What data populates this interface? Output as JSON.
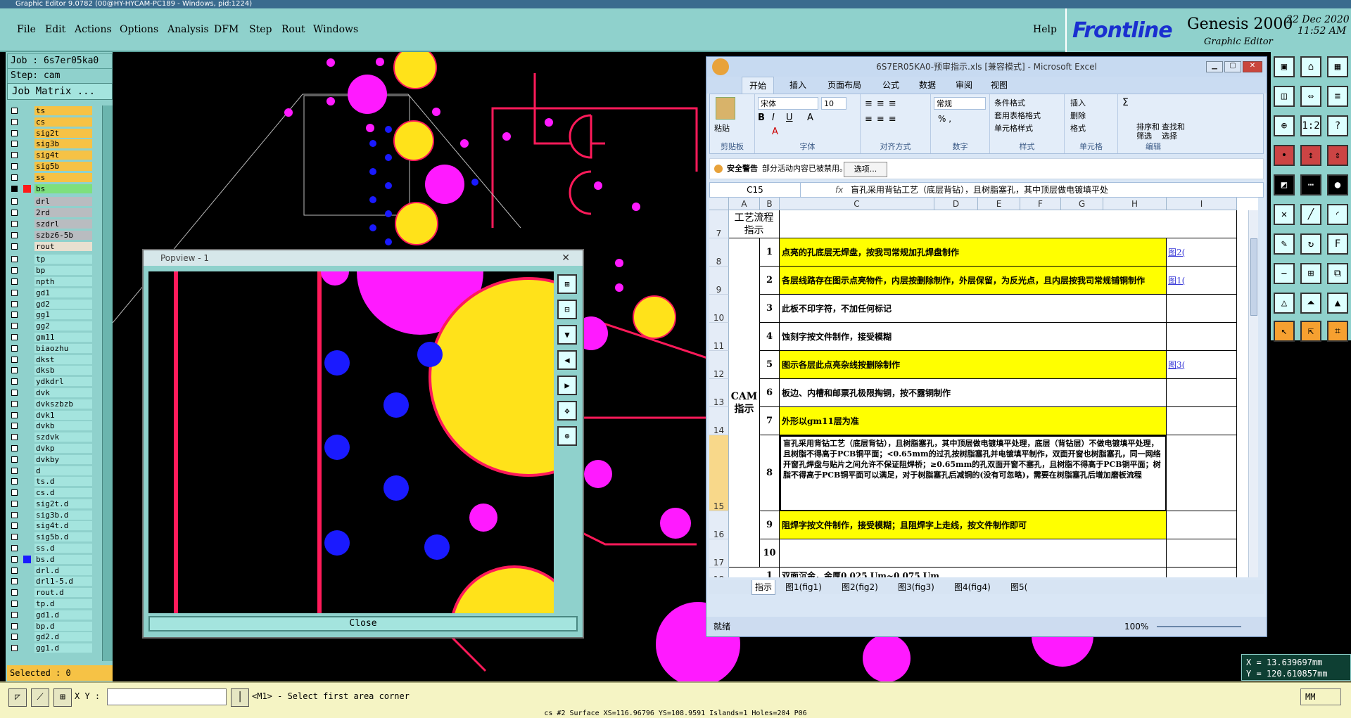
{
  "window": {
    "title": "Graphic Editor 9.0782 (00@HY-HYCAM-PC189 - Windows, pid:1224)"
  },
  "menu": {
    "items": [
      "File",
      "Edit",
      "Actions",
      "Options",
      "Analysis",
      "DFM",
      "Step",
      "Rout",
      "Windows"
    ],
    "help": "Help"
  },
  "brand": {
    "logo": "Frontline",
    "product": "Genesis 2000",
    "subtitle": "Graphic Editor",
    "date": "22 Dec 2020",
    "time": "11:52 AM"
  },
  "job": {
    "job_label": "Job : 6s7er05ka0",
    "step_label": "Step: cam",
    "matrix_button": "Job Matrix ..."
  },
  "layers": [
    {
      "name": "ts",
      "color": "#f6c245",
      "checked": false
    },
    {
      "name": "cs",
      "color": "#f6c245",
      "checked": false
    },
    {
      "name": "sig2t",
      "color": "#f6c245",
      "checked": false
    },
    {
      "name": "sig3b",
      "color": "#f6c245",
      "checked": false
    },
    {
      "name": "sig4t",
      "color": "#f6c245",
      "checked": false
    },
    {
      "name": "sig5b",
      "color": "#f6c245",
      "checked": false
    },
    {
      "name": "ss",
      "color": "#f6c245",
      "checked": false
    },
    {
      "name": "bs",
      "color": "#7de07d",
      "checked": true,
      "swatch": "#ff1a1a"
    },
    {
      "name": "drl",
      "color": "#b9bcc0",
      "checked": false
    },
    {
      "name": "2rd",
      "color": "#b9bcc0",
      "checked": false
    },
    {
      "name": "szdrl",
      "color": "#b9bcc0",
      "checked": false
    },
    {
      "name": "szbz6-5b",
      "color": "#b9bcc0",
      "checked": false
    },
    {
      "name": "rout",
      "color": "#e8e0d0",
      "checked": false
    },
    {
      "name": "tp",
      "color": "#a4e4de",
      "checked": false
    },
    {
      "name": "bp",
      "color": "#a4e4de",
      "checked": false
    },
    {
      "name": "npth",
      "color": "#a4e4de",
      "checked": false
    },
    {
      "name": "gd1",
      "color": "#a4e4de",
      "checked": false
    },
    {
      "name": "gd2",
      "color": "#a4e4de",
      "checked": false
    },
    {
      "name": "gg1",
      "color": "#a4e4de",
      "checked": false
    },
    {
      "name": "gg2",
      "color": "#a4e4de",
      "checked": false
    },
    {
      "name": "gm11",
      "color": "#a4e4de",
      "checked": false
    },
    {
      "name": "biaozhu",
      "color": "#a4e4de",
      "checked": false
    },
    {
      "name": "dkst",
      "color": "#a4e4de",
      "checked": false
    },
    {
      "name": "dksb",
      "color": "#a4e4de",
      "checked": false
    },
    {
      "name": "ydkdrl",
      "color": "#a4e4de",
      "checked": false
    },
    {
      "name": "dvk",
      "color": "#a4e4de",
      "checked": false
    },
    {
      "name": "dvkszbzb",
      "color": "#a4e4de",
      "checked": false
    },
    {
      "name": "dvk1",
      "color": "#a4e4de",
      "checked": false
    },
    {
      "name": "dvkb",
      "color": "#a4e4de",
      "checked": false
    },
    {
      "name": "szdvk",
      "color": "#a4e4de",
      "checked": false
    },
    {
      "name": "dvkp",
      "color": "#a4e4de",
      "checked": false
    },
    {
      "name": "dvkby",
      "color": "#a4e4de",
      "checked": false
    },
    {
      "name": "d",
      "color": "#a4e4de",
      "checked": false
    },
    {
      "name": "ts.d",
      "color": "#a4e4de",
      "checked": false
    },
    {
      "name": "cs.d",
      "color": "#a4e4de",
      "checked": false
    },
    {
      "name": "sig2t.d",
      "color": "#a4e4de",
      "checked": false
    },
    {
      "name": "sig3b.d",
      "color": "#a4e4de",
      "checked": false
    },
    {
      "name": "sig4t.d",
      "color": "#a4e4de",
      "checked": false
    },
    {
      "name": "sig5b.d",
      "color": "#a4e4de",
      "checked": false
    },
    {
      "name": "ss.d",
      "color": "#a4e4de",
      "checked": false
    },
    {
      "name": "bs.d",
      "color": "#a4e4de",
      "checked": false,
      "swatch": "#1a1aff"
    },
    {
      "name": "drl.d",
      "color": "#a4e4de",
      "checked": false
    },
    {
      "name": "drl1-5.d",
      "color": "#a4e4de",
      "checked": false
    },
    {
      "name": "rout.d",
      "color": "#a4e4de",
      "checked": false
    },
    {
      "name": "tp.d",
      "color": "#a4e4de",
      "checked": false
    },
    {
      "name": "gd1.d",
      "color": "#a4e4de",
      "checked": false
    },
    {
      "name": "bp.d",
      "color": "#a4e4de",
      "checked": false
    },
    {
      "name": "gd2.d",
      "color": "#a4e4de",
      "checked": false
    },
    {
      "name": "gg1.d",
      "color": "#a4e4de",
      "checked": false
    }
  ],
  "selected": "Selected : 0",
  "bottom": {
    "xy_label": "X Y :",
    "xy_value": "",
    "prompt": "<M1> - Select first area corner",
    "units": "MM"
  },
  "statusbar": "cs #2 Surface XS=116.96796 YS=108.9591 Islands=1 Holes=204 P06",
  "coords": {
    "x": "X = 13.639697mm",
    "y": "Y = 120.610857mm"
  },
  "popview": {
    "title": "Popview - 1",
    "close": "Close"
  },
  "excel": {
    "title": "6S7ER05KA0-预审指示.xls [兼容模式] - Microsoft Excel",
    "tabs": [
      "开始",
      "插入",
      "页面布局",
      "公式",
      "数据",
      "审阅",
      "视图"
    ],
    "ribbon": {
      "paste": "粘贴",
      "clipboard": "剪贴板",
      "font_name": "宋体",
      "font_size": "10",
      "font": "字体",
      "align": "对齐方式",
      "numfmt": "常规",
      "number": "数字",
      "cond": "条件格式",
      "table": "套用表格格式",
      "cellstyle": "单元格样式",
      "styles": "样式",
      "insert": "插入",
      "delete": "删除",
      "format": "格式",
      "cells": "单元格",
      "sort": "排序和筛选",
      "find": "查找和选择",
      "edit": "编辑"
    },
    "security": {
      "label": "安全警告",
      "message": "部分活动内容已被禁用。",
      "button": "选项..."
    },
    "namebox": "C15",
    "formula": "盲孔采用背钻工艺（底层背钻），且树脂塞孔，其中顶层做电镀填平处",
    "columns": [
      "A",
      "B",
      "C",
      "D",
      "E",
      "F",
      "G",
      "H",
      "I"
    ],
    "header_cell": "工艺流程\n指示",
    "cam_label": "CAM\n指示",
    "rows": [
      {
        "row": "7",
        "num": "",
        "text": "",
        "hl": false,
        "link": ""
      },
      {
        "row": "8",
        "num": "1",
        "text": "点亮的孔底层无焊盘，按我司常规加孔焊盘制作",
        "hl": true,
        "link": "图2("
      },
      {
        "row": "9",
        "num": "2",
        "text": "各层线路存在图示点亮物件，内层按删除制作，外层保留，为反光点，且内层按我司常规铺铜制作",
        "hl": true,
        "link": "图1("
      },
      {
        "row": "10",
        "num": "3",
        "text": "此板不印字符，不加任何标记",
        "hl": false,
        "link": ""
      },
      {
        "row": "11",
        "num": "4",
        "text": "蚀刻字按文件制作，接受模糊",
        "hl": false,
        "link": ""
      },
      {
        "row": "12",
        "num": "5",
        "text": "图示各层此点亮杂线按删除制作",
        "hl": true,
        "link": "图3("
      },
      {
        "row": "13",
        "num": "6",
        "text": "板边、内槽和邮票孔极限掏铜，按不露铜制作",
        "hl": false,
        "link": ""
      },
      {
        "row": "14",
        "num": "7",
        "text": "外形以gm11层为准",
        "hl": true,
        "link": ""
      },
      {
        "row": "15",
        "num": "8",
        "text": "盲孔采用背钻工艺（底层背钻），且树脂塞孔，其中顶层做电镀填平处理，底层（背钻层）不做电镀填平处理，且树脂不得高于PCB铜平面；<0.65mm的过孔按树脂塞孔并电镀填平制作，双面开窗也树脂塞孔，同一网络开窗孔焊盘与贴片之间允许不保证阻焊桥；≥0.65mm的孔双面开窗不塞孔，且树脂不得高于PCB铜平面；树脂不得高于PCB铜平面可以满足，对于树脂塞孔后减铜的(没有可忽略)，需要在树脂塞孔后增加磨板流程",
        "hl": false,
        "link": ""
      },
      {
        "row": "16",
        "num": "9",
        "text": "阻焊字按文件制作，接受模糊；且阻焊字上走线，按文件制作即可",
        "hl": true,
        "link": ""
      },
      {
        "row": "17",
        "num": "10",
        "text": "",
        "hl": false,
        "link": ""
      },
      {
        "row": "18",
        "num": "1",
        "text": "双面沉金，金厚0.025 Um~0.075 Um",
        "hl": false,
        "link": ""
      }
    ],
    "sheets": [
      "指示",
      "图1(fig1)",
      "图2(fig2)",
      "图3(fig3)",
      "图4(fig4)",
      "图5("
    ],
    "status": {
      "ready": "就绪",
      "zoom": "100%"
    }
  }
}
